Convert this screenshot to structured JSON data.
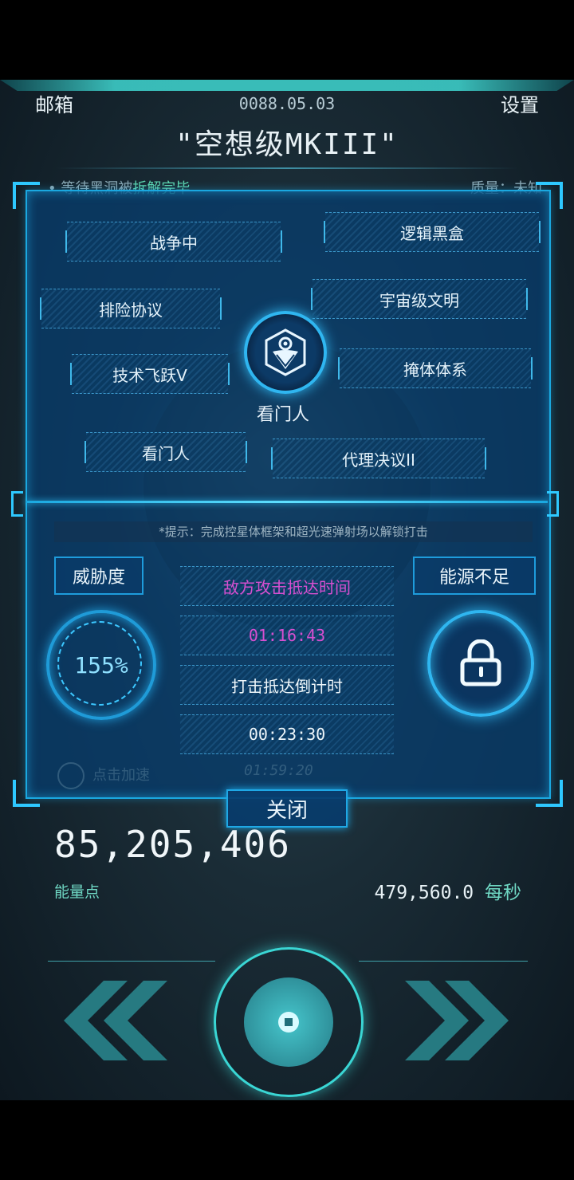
{
  "header": {
    "mail_label": "邮箱",
    "date": "0088.05.03",
    "settings_label": "设置",
    "ship_name": "\"空想级MKIII\"",
    "ticker_text": "• 等待黑洞被",
    "ticker_highlight": "拆解完毕",
    "ticker_right": "质量：未知"
  },
  "tech_tree": {
    "nodes": [
      "战争中",
      "逻辑黑盒",
      "排险协议",
      "宇宙级文明",
      "技术飞跃V",
      "掩体体系",
      "看门人",
      "代理决议II"
    ],
    "center_label": "看门人"
  },
  "hint": "*提示：完成控星体框架和超光速弹射场以解锁打击",
  "threat": {
    "label": "威胁度",
    "value": "155%"
  },
  "power_status": "能源不足",
  "timers": {
    "enemy_label": "敌方攻击抵达时间",
    "enemy_time": "01:16:43",
    "strike_label": "打击抵达倒计时",
    "strike_time": "00:23:30"
  },
  "background_ghost": {
    "accelerate": "点击加速",
    "time": "01:59:20"
  },
  "close_label": "关闭",
  "energy": {
    "value": "85,205,406",
    "label": "能量点",
    "rate": "479,560.0",
    "rate_unit": "每秒"
  },
  "colors": {
    "accent_blue": "#1aa8e0",
    "accent_teal": "#3ad6d4",
    "highlight_green": "#5ed6b0",
    "enemy_magenta": "#d64fd0"
  }
}
